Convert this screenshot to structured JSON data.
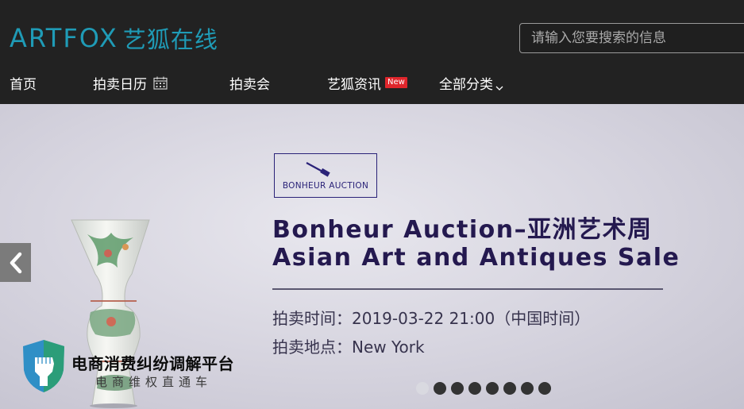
{
  "header": {
    "logo_en": "ARTFOX",
    "logo_cn": "艺狐在线",
    "brand_color": "#1f9bb6"
  },
  "search": {
    "placeholder": "请输入您要搜索的信息"
  },
  "nav": {
    "items": [
      {
        "label": "首页"
      },
      {
        "label": "拍卖日历",
        "icon": "calendar-icon"
      },
      {
        "label": "拍卖会"
      },
      {
        "label": "艺狐资讯",
        "badge": "New"
      },
      {
        "label": "全部分类",
        "icon": "chevron-down-icon"
      }
    ]
  },
  "banner": {
    "auction_logo_text": "BONHEUR AUCTION",
    "title_line1": "Bonheur Auction–亚洲艺术周",
    "title_line2": "Asian Art and Antiques Sale",
    "time_line": "拍卖时间：2019-03-22 21:00（中国时间）",
    "place_line": "拍卖地点：New York",
    "prev_arrow": "❮",
    "slide_count": 8,
    "active_slide": 1
  },
  "watermark": {
    "title": "电商消费纠纷调解平台",
    "subtitle": "电商维权直通车"
  }
}
